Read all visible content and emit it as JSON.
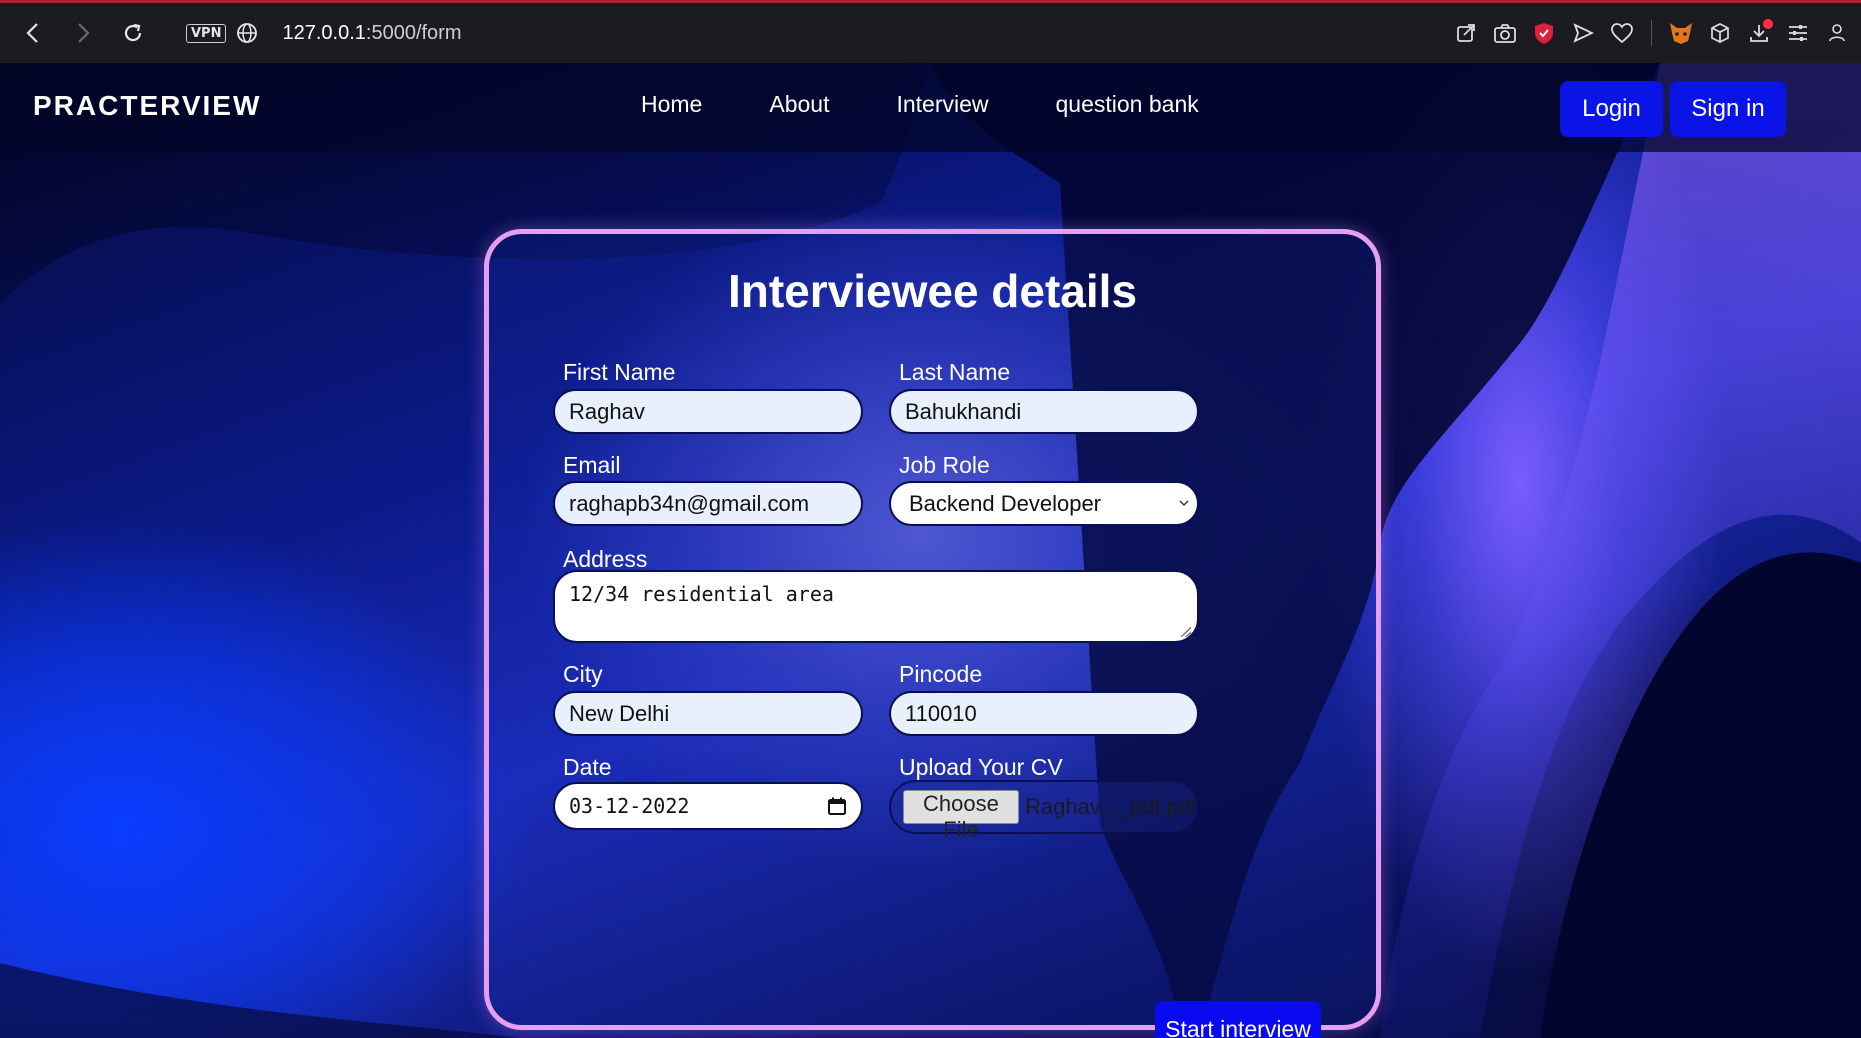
{
  "browser": {
    "vpn_label": "VPN",
    "url_host": "127.0.0.1",
    "url_path": ":5000/form"
  },
  "navbar": {
    "brand": "PRACTERVIEW",
    "links": [
      "Home",
      "About",
      "Interview",
      "question bank"
    ],
    "login_label": "Login",
    "signin_label": "Sign in"
  },
  "form": {
    "title": "Interviewee details",
    "first_name": {
      "label": "First Name",
      "value": "Raghav"
    },
    "last_name": {
      "label": "Last Name",
      "value": "Bahukhandi"
    },
    "email": {
      "label": "Email",
      "value": "raghapb34n@gmail.com"
    },
    "job_role": {
      "label": "Job Role",
      "value": "Backend Developer"
    },
    "address": {
      "label": "Address",
      "value": "12/34 residential area"
    },
    "city": {
      "label": "City",
      "value": "New Delhi"
    },
    "pincode": {
      "label": "Pincode",
      "value": "110010"
    },
    "date": {
      "label": "Date",
      "value": "03-12-2022"
    },
    "cv": {
      "label": "Upload Your CV",
      "button": "Choose File",
      "file_name": "Raghav..._pdf.pdf"
    },
    "submit_label": "Start interview"
  },
  "colors": {
    "accent_button": "#0a14e6",
    "card_border": "#e59ef0"
  }
}
